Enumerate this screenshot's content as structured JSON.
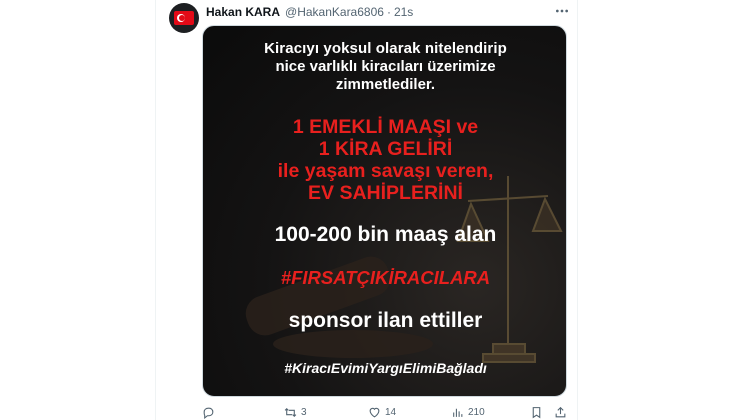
{
  "tweet": {
    "author_name": "Hakan KARA",
    "handle": "@HakanKara6806",
    "separator": "·",
    "time": "21s",
    "image_text": {
      "white_lines": [
        "Kiracıyı yoksul olarak nitelendirip",
        "nice varlıklı kiracıları üzerimize",
        "zimmetlediler."
      ],
      "red_lines": [
        "1 EMEKLİ MAAŞI ve",
        "1 KİRA GELİRİ",
        "ile yaşam savaşı veren,",
        "EV SAHİPLERİNİ"
      ],
      "line_white_1": "100-200 bin maaş alan",
      "hashtag_red": "#FIRSATÇIKİRACILARA",
      "line_white_2": "sponsor ilan ettiller",
      "hashtag_white": "#KiracıEvimiYargıElimiBağladı"
    },
    "actions": {
      "reply_count": "",
      "retweet_count": "3",
      "like_count": "14",
      "views_count": "210"
    }
  },
  "colors": {
    "accent_red": "#e8201e",
    "image_background": "#141313",
    "secondary_text": "#536471"
  },
  "icons": {
    "avatar": "turkish-flag-avatar",
    "more": "more-options-icon",
    "reply": "reply-icon",
    "retweet": "retweet-icon",
    "like": "heart-icon",
    "views": "views-icon",
    "bookmark": "bookmark-icon"
  }
}
